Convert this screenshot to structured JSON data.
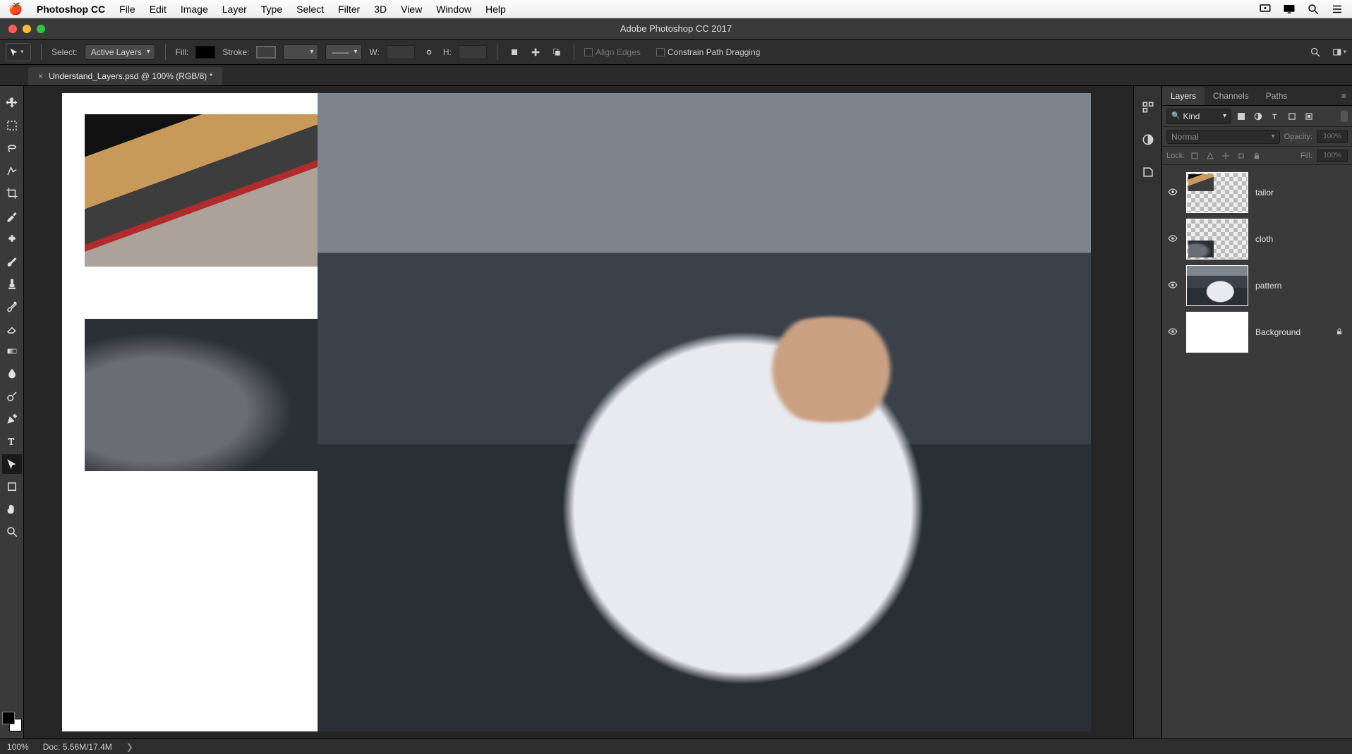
{
  "mac_menu": {
    "app": "Photoshop CC",
    "items": [
      "File",
      "Edit",
      "Image",
      "Layer",
      "Type",
      "Select",
      "Filter",
      "3D",
      "View",
      "Window",
      "Help"
    ]
  },
  "window": {
    "title": "Adobe Photoshop CC 2017"
  },
  "options": {
    "select_label": "Select:",
    "select_value": "Active Layers",
    "fill_label": "Fill:",
    "stroke_label": "Stroke:",
    "w_label": "W:",
    "h_label": "H:",
    "align_edges": "Align Edges",
    "constrain": "Constrain Path Dragging"
  },
  "document": {
    "tab_title": "Understand_Layers.psd @ 100% (RGB/8) *"
  },
  "panels": {
    "tabs": [
      "Layers",
      "Channels",
      "Paths"
    ],
    "active_tab": "Layers",
    "kind_label": "Kind",
    "blend_mode": "Normal",
    "opacity_label": "Opacity:",
    "opacity_value": "100%",
    "lock_label": "Lock:",
    "fill_label": "Fill:",
    "fill_value": "100%",
    "layers": [
      {
        "name": "tailor",
        "visible": true,
        "thumb_style": "checker-small",
        "locked": false
      },
      {
        "name": "cloth",
        "visible": true,
        "thumb_style": "checker-small2",
        "locked": false
      },
      {
        "name": "pattern",
        "visible": true,
        "thumb_style": "full-dark",
        "locked": false
      },
      {
        "name": "Background",
        "visible": true,
        "thumb_style": "white",
        "locked": true
      }
    ]
  },
  "status": {
    "zoom": "100%",
    "doc_info": "Doc: 5.56M/17.4M"
  }
}
